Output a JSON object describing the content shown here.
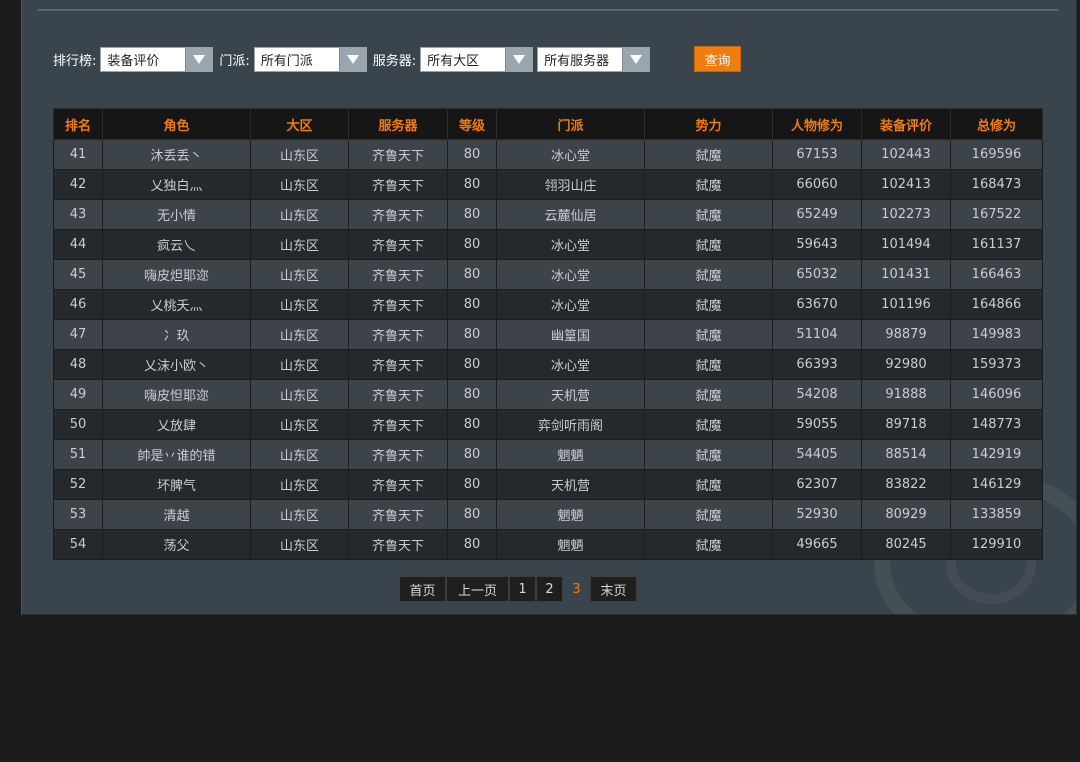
{
  "filters": {
    "ranking_label": "排行榜:",
    "ranking_value": "装备评价",
    "sect_label": "门派:",
    "sect_value": "所有门派",
    "server_label": "服务器:",
    "region_value": "所有大区",
    "server_value": "所有服务器",
    "query_label": "查询"
  },
  "table": {
    "headers": [
      "排名",
      "角色",
      "大区",
      "服务器",
      "等级",
      "门派",
      "势力",
      "人物修为",
      "装备评价",
      "总修为"
    ],
    "rows": [
      [
        "41",
        "沐丢丢丶",
        "山东区",
        "齐鲁天下",
        "80",
        "冰心堂",
        "弑魔",
        "67153",
        "102443",
        "169596"
      ],
      [
        "42",
        "乂独白灬",
        "山东区",
        "齐鲁天下",
        "80",
        "翎羽山庄",
        "弑魔",
        "66060",
        "102413",
        "168473"
      ],
      [
        "43",
        "无小情",
        "山东区",
        "齐鲁天下",
        "80",
        "云麓仙居",
        "弑魔",
        "65249",
        "102273",
        "167522"
      ],
      [
        "44",
        "疯云乀",
        "山东区",
        "齐鲁天下",
        "80",
        "冰心堂",
        "弑魔",
        "59643",
        "101494",
        "161137"
      ],
      [
        "45",
        "嗨皮炟耶迩",
        "山东区",
        "齐鲁天下",
        "80",
        "冰心堂",
        "弑魔",
        "65032",
        "101431",
        "166463"
      ],
      [
        "46",
        "乂桃夭灬",
        "山东区",
        "齐鲁天下",
        "80",
        "冰心堂",
        "弑魔",
        "63670",
        "101196",
        "164866"
      ],
      [
        "47",
        "冫玖",
        "山东区",
        "齐鲁天下",
        "80",
        "幽篁国",
        "弑魔",
        "51104",
        "98879",
        "149983"
      ],
      [
        "48",
        "乂沫小欧丶",
        "山东区",
        "齐鲁天下",
        "80",
        "冰心堂",
        "弑魔",
        "66393",
        "92980",
        "159373"
      ],
      [
        "49",
        "嗨皮怛耶迩",
        "山东区",
        "齐鲁天下",
        "80",
        "天机营",
        "弑魔",
        "54208",
        "91888",
        "146096"
      ],
      [
        "50",
        "乂放肆",
        "山东区",
        "齐鲁天下",
        "80",
        "弈剑听雨阁",
        "弑魔",
        "59055",
        "89718",
        "148773"
      ],
      [
        "51",
        "帥是丷谁的错",
        "山东区",
        "齐鲁天下",
        "80",
        "魍魉",
        "弑魔",
        "54405",
        "88514",
        "142919"
      ],
      [
        "52",
        "坏脾气",
        "山东区",
        "齐鲁天下",
        "80",
        "天机营",
        "弑魔",
        "62307",
        "83822",
        "146129"
      ],
      [
        "53",
        "清越",
        "山东区",
        "齐鲁天下",
        "80",
        "魍魉",
        "弑魔",
        "52930",
        "80929",
        "133859"
      ],
      [
        "54",
        "荡父",
        "山东区",
        "齐鲁天下",
        "80",
        "魍魉",
        "弑魔",
        "49665",
        "80245",
        "129910"
      ]
    ]
  },
  "pagination": {
    "first": "首页",
    "prev": "上一页",
    "pages": [
      "1",
      "2",
      "3"
    ],
    "current": "3",
    "last": "末页"
  },
  "colors": {
    "accent": "#ef7d10",
    "panel": "#3a444c",
    "header_bg": "#161616"
  }
}
